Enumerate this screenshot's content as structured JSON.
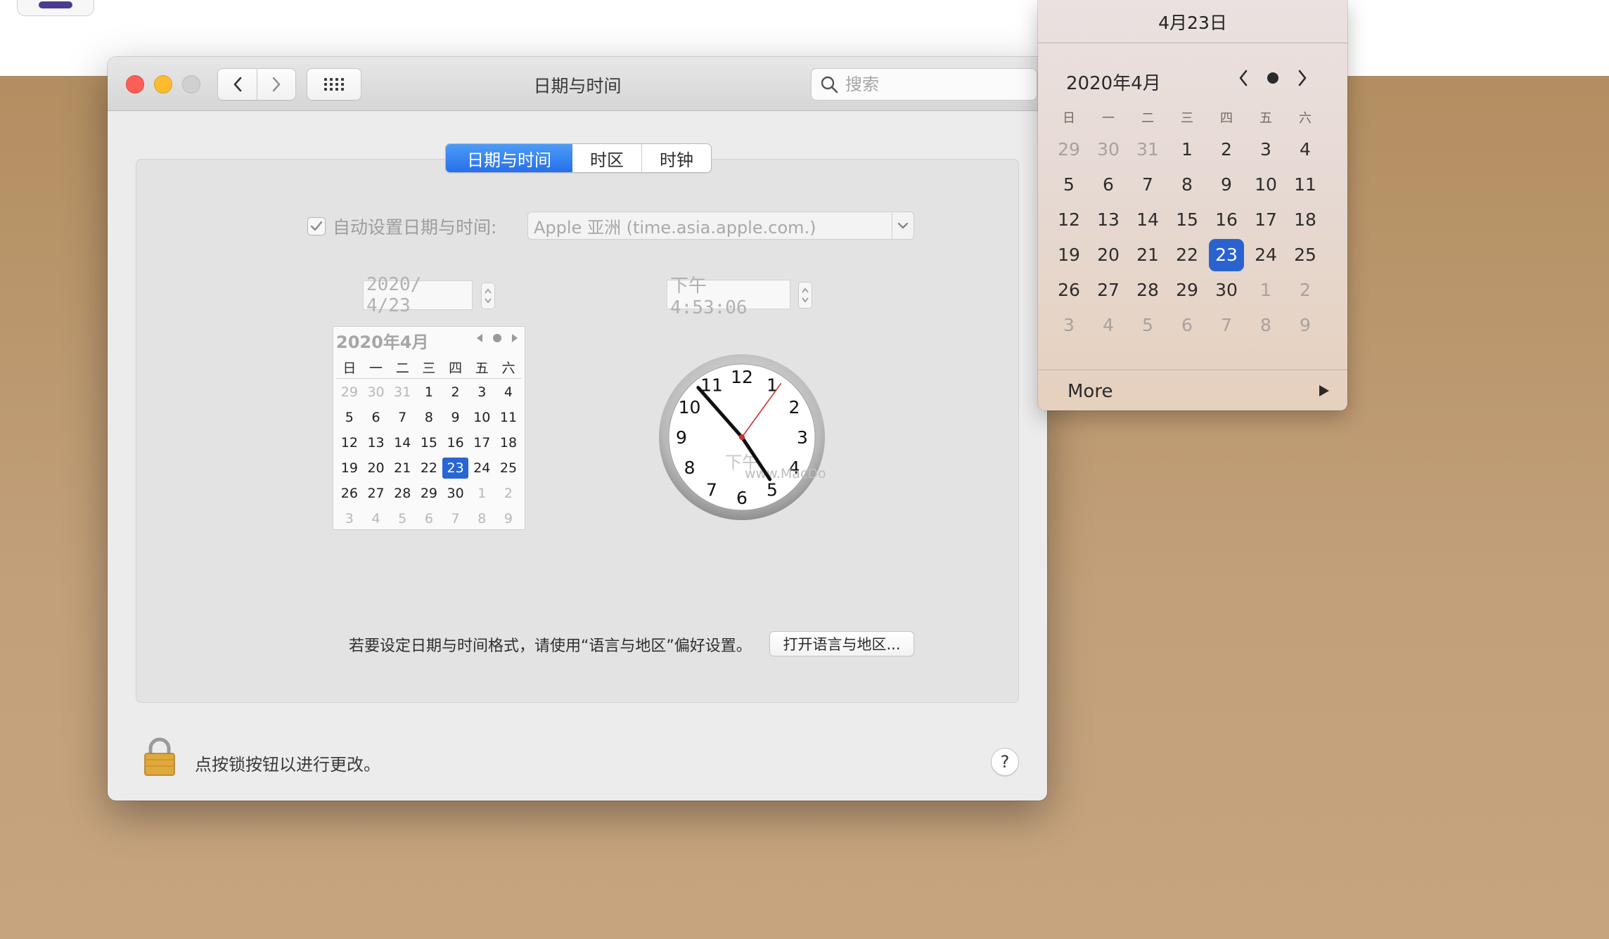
{
  "window": {
    "title": "日期与时间",
    "search_placeholder": "搜索"
  },
  "tabs": [
    {
      "label": "日期与时间",
      "selected": true
    },
    {
      "label": "时区",
      "selected": false
    },
    {
      "label": "时钟",
      "selected": false
    }
  ],
  "auto_setting": {
    "label": "自动设置日期与时间:",
    "checked": true,
    "server": "Apple 亚洲 (time.asia.apple.com.)"
  },
  "date_field": "2020/  4/23",
  "time_field": "下午  4:53:06",
  "mini_calendar": {
    "header": "2020年4月",
    "weekdays": [
      "日",
      "一",
      "二",
      "三",
      "四",
      "五",
      "六"
    ],
    "weeks": [
      [
        "29",
        "30",
        "31",
        "1",
        "2",
        "3",
        "4"
      ],
      [
        "5",
        "6",
        "7",
        "8",
        "9",
        "10",
        "11"
      ],
      [
        "12",
        "13",
        "14",
        "15",
        "16",
        "17",
        "18"
      ],
      [
        "19",
        "20",
        "21",
        "22",
        "23",
        "24",
        "25"
      ],
      [
        "26",
        "27",
        "28",
        "29",
        "30",
        "1",
        "2"
      ],
      [
        "3",
        "4",
        "5",
        "6",
        "7",
        "8",
        "9"
      ]
    ],
    "selected": "23"
  },
  "analog_clock": {
    "ampm": "下午",
    "hour": 4,
    "minute": 53,
    "second": 6,
    "numerals": [
      "12",
      "1",
      "2",
      "3",
      "4",
      "5",
      "6",
      "7",
      "8",
      "9",
      "10",
      "11"
    ],
    "watermark": "www.MacDown.com"
  },
  "format_note": "若要设定日期与时间格式，请使用“语言与地区”偏好设置。",
  "open_region_button": "打开语言与地区...",
  "lock_text": "点按锁按钮以进行更改。",
  "help_label": "?",
  "popover": {
    "date_title": "4月23日",
    "month_label": "2020年4月",
    "weekdays": [
      "日",
      "一",
      "二",
      "三",
      "四",
      "五",
      "六"
    ],
    "weeks": [
      [
        "29",
        "30",
        "31",
        "1",
        "2",
        "3",
        "4"
      ],
      [
        "5",
        "6",
        "7",
        "8",
        "9",
        "10",
        "11"
      ],
      [
        "12",
        "13",
        "14",
        "15",
        "16",
        "17",
        "18"
      ],
      [
        "19",
        "20",
        "21",
        "22",
        "23",
        "24",
        "25"
      ],
      [
        "26",
        "27",
        "28",
        "29",
        "30",
        "1",
        "2"
      ],
      [
        "3",
        "4",
        "5",
        "6",
        "7",
        "8",
        "9"
      ]
    ],
    "selected": "23",
    "more_label": "More"
  },
  "colors": {
    "accent": "#2670ea",
    "selected_day": "#2866d4",
    "close": "#fc5f57",
    "minimize": "#fdbc2e",
    "desktop": "#c09a6e"
  }
}
